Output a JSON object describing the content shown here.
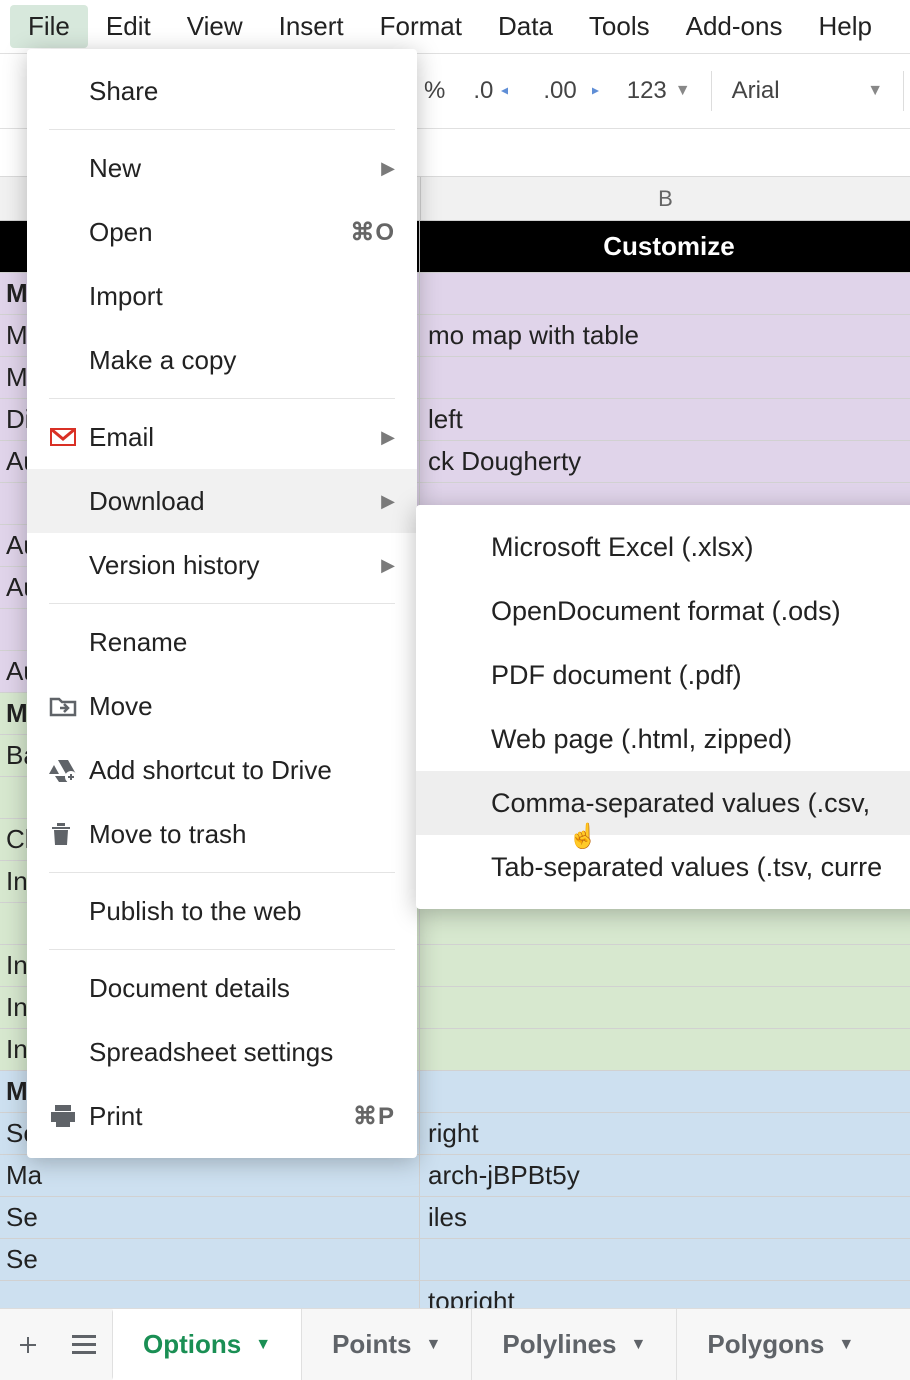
{
  "menubar": {
    "items": [
      "File",
      "Edit",
      "View",
      "Insert",
      "Format",
      "Data",
      "Tools",
      "Add-ons",
      "Help"
    ],
    "activeIndex": 0
  },
  "toolbar": {
    "percent": "%",
    "dec1": ".0",
    "dec2": ".00",
    "numfmt": "123",
    "font": "Arial"
  },
  "columns": {
    "b": "B"
  },
  "rows": [
    {
      "style": "black",
      "a": "",
      "b": "Customize"
    },
    {
      "style": "purple bold",
      "a": "Ma",
      "b": ""
    },
    {
      "style": "purple",
      "a": "Ma",
      "b": "mo map with table"
    },
    {
      "style": "purple",
      "a": "Ma",
      "b": ""
    },
    {
      "style": "purple",
      "a": "Dis",
      "b": "left"
    },
    {
      "style": "purple",
      "a": "Au",
      "b": "ck Dougherty"
    },
    {
      "style": "purple",
      "a": "",
      "b": ""
    },
    {
      "style": "purple",
      "a": "Au",
      "b": ""
    },
    {
      "style": "purple",
      "a": "Au",
      "b": ""
    },
    {
      "style": "purple",
      "a": "",
      "b": ""
    },
    {
      "style": "purple",
      "a": "Au",
      "b": ""
    },
    {
      "style": "green bold",
      "a": "Ma",
      "b": ""
    },
    {
      "style": "green",
      "a": "Ba",
      "b": ""
    },
    {
      "style": "green",
      "a": "",
      "b": ""
    },
    {
      "style": "green",
      "a": "Clu",
      "b": ""
    },
    {
      "style": "green",
      "a": "Int",
      "b": ""
    },
    {
      "style": "green",
      "a": "",
      "b": ""
    },
    {
      "style": "green",
      "a": "Init",
      "b": ""
    },
    {
      "style": "green",
      "a": "Init",
      "b": ""
    },
    {
      "style": "green",
      "a": "Init",
      "b": ""
    },
    {
      "style": "blue bold",
      "a": "Ma",
      "b": ""
    },
    {
      "style": "blue",
      "a": "Se",
      "b": "right"
    },
    {
      "style": "blue",
      "a": "Ma",
      "b": "arch-jBPBt5y"
    },
    {
      "style": "blue",
      "a": "Se",
      "b": "iles"
    },
    {
      "style": "blue",
      "a": "Se",
      "b": ""
    },
    {
      "style": "blue",
      "a": "",
      "b": "topright"
    }
  ],
  "file_menu": {
    "items": [
      {
        "label": "Share",
        "icon": null,
        "kbd": null,
        "chev": false,
        "div_after": true
      },
      {
        "label": "New",
        "icon": null,
        "kbd": null,
        "chev": true
      },
      {
        "label": "Open",
        "icon": null,
        "kbd": "⌘O",
        "chev": false
      },
      {
        "label": "Import",
        "icon": null,
        "kbd": null,
        "chev": false
      },
      {
        "label": "Make a copy",
        "icon": null,
        "kbd": null,
        "chev": false,
        "div_after": true
      },
      {
        "label": "Email",
        "icon": "gmail",
        "kbd": null,
        "chev": true
      },
      {
        "label": "Download",
        "icon": null,
        "kbd": null,
        "chev": true,
        "hover": true
      },
      {
        "label": "Version history",
        "icon": null,
        "kbd": null,
        "chev": true,
        "div_after": true
      },
      {
        "label": "Rename",
        "icon": null,
        "kbd": null,
        "chev": false
      },
      {
        "label": "Move",
        "icon": "folder-move",
        "kbd": null,
        "chev": false
      },
      {
        "label": "Add shortcut to Drive",
        "icon": "drive-add",
        "kbd": null,
        "chev": false
      },
      {
        "label": "Move to trash",
        "icon": "trash",
        "kbd": null,
        "chev": false,
        "div_after": true
      },
      {
        "label": "Publish to the web",
        "icon": null,
        "kbd": null,
        "chev": false,
        "div_after": true
      },
      {
        "label": "Document details",
        "icon": null,
        "kbd": null,
        "chev": false
      },
      {
        "label": "Spreadsheet settings",
        "icon": null,
        "kbd": null,
        "chev": false
      },
      {
        "label": "Print",
        "icon": "print",
        "kbd": "⌘P",
        "chev": false
      }
    ]
  },
  "download_submenu": {
    "items": [
      {
        "label": "Microsoft Excel (.xlsx)"
      },
      {
        "label": "OpenDocument format (.ods)"
      },
      {
        "label": "PDF document (.pdf)"
      },
      {
        "label": "Web page (.html, zipped)"
      },
      {
        "label": "Comma-separated values (.csv,",
        "hover": true
      },
      {
        "label": "Tab-separated values (.tsv, curre"
      }
    ]
  },
  "sheet_tabs": {
    "tabs": [
      {
        "label": "Options",
        "active": true
      },
      {
        "label": "Points",
        "active": false
      },
      {
        "label": "Polylines",
        "active": false
      },
      {
        "label": "Polygons",
        "active": false
      }
    ]
  }
}
